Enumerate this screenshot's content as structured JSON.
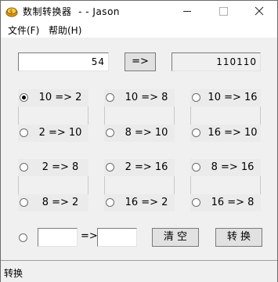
{
  "window": {
    "title": "数制转换器  - - Jason",
    "minimize_icon": "minimize-icon",
    "maximize_icon": "maximize-icon",
    "close_icon": "close-icon",
    "app_icon": "coin-icon"
  },
  "menu": {
    "file": "文件(F)",
    "help": "帮助(H)"
  },
  "top_row": {
    "input_value": "54",
    "convert_symbol": "=>",
    "result_value": "110110"
  },
  "options": [
    {
      "label": "10 => 2",
      "selected": true
    },
    {
      "label": "10 => 8",
      "selected": false
    },
    {
      "label": "10 => 16",
      "selected": false
    },
    {
      "label": "2 => 10",
      "selected": false
    },
    {
      "label": "8 => 10",
      "selected": false
    },
    {
      "label": "16 => 10",
      "selected": false
    },
    {
      "label": "2 => 8",
      "selected": false
    },
    {
      "label": "2 => 16",
      "selected": false
    },
    {
      "label": "8 => 16",
      "selected": false
    },
    {
      "label": "8 => 2",
      "selected": false
    },
    {
      "label": "16 => 2",
      "selected": false
    },
    {
      "label": "16 => 8",
      "selected": false
    }
  ],
  "custom_row": {
    "from_value": "",
    "arrow": "=>",
    "to_value": "",
    "clear_label": "清 空",
    "convert_label": "转 换"
  },
  "status": {
    "text": "转换"
  }
}
